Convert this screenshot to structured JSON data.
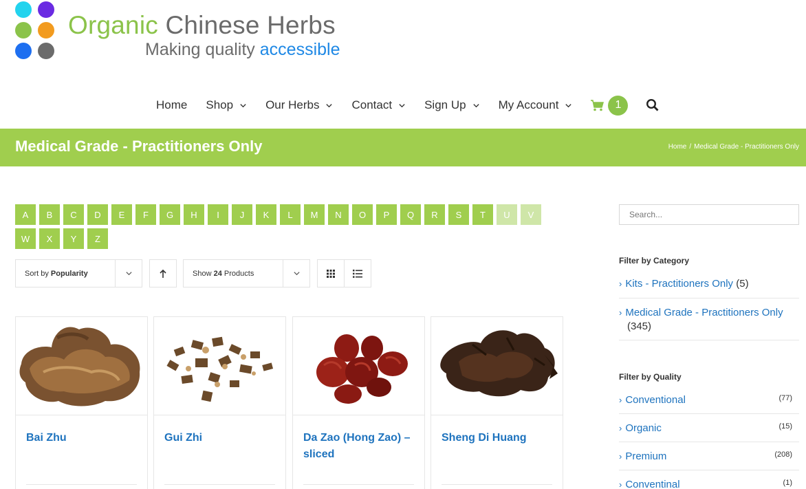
{
  "brand": {
    "name_part1": "Organic",
    "name_part2": "Chinese Herbs",
    "tagline_part1": "Making quality",
    "tagline_part2": "accessible",
    "colors": {
      "green": "#8bc34a",
      "blue": "#1e88e5",
      "gray": "#6b6b6b"
    }
  },
  "nav": {
    "items": [
      {
        "label": "Home",
        "has_menu": false
      },
      {
        "label": "Shop",
        "has_menu": true
      },
      {
        "label": "Our Herbs",
        "has_menu": true
      },
      {
        "label": "Contact",
        "has_menu": true
      },
      {
        "label": "Sign Up",
        "has_menu": true
      },
      {
        "label": "My Account",
        "has_menu": true
      }
    ],
    "cart_count": "1",
    "cart_icon": "cart-icon",
    "search_icon": "search-icon"
  },
  "page": {
    "title": "Medical Grade - Practitioners Only",
    "breadcrumb": [
      "Home",
      "Medical Grade - Practitioners Only"
    ],
    "accent": "#a0ce4e"
  },
  "alphabet": {
    "letters": [
      "A",
      "B",
      "C",
      "D",
      "E",
      "F",
      "G",
      "H",
      "I",
      "J",
      "K",
      "L",
      "M",
      "N",
      "O",
      "P",
      "Q",
      "R",
      "S",
      "T",
      "U",
      "V",
      "W",
      "X",
      "Y",
      "Z"
    ],
    "disabled": [
      "U",
      "V"
    ]
  },
  "controls": {
    "sort_prefix": "Sort by",
    "sort_value": "Popularity",
    "show_prefix": "Show",
    "show_value": "24 Products",
    "show_suffix": "Products",
    "show_count": "24"
  },
  "products": [
    {
      "name": "Bai Zhu"
    },
    {
      "name": "Gui Zhi"
    },
    {
      "name": "Da Zao (Hong Zao) – sliced"
    },
    {
      "name": "Sheng Di Huang"
    }
  ],
  "sidebar": {
    "search_placeholder": "Search...",
    "category_heading": "Filter by Category",
    "categories": [
      {
        "label": "Kits - Practitioners Only",
        "count": "(5)"
      },
      {
        "label": "Medical Grade - Practitioners Only",
        "count": "(345)"
      }
    ],
    "quality_heading": "Filter by Quality",
    "qualities": [
      {
        "label": "Conventional",
        "count": "(77)"
      },
      {
        "label": "Organic",
        "count": "(15)"
      },
      {
        "label": "Premium",
        "count": "(208)"
      },
      {
        "label": "Conventinal",
        "count": "(1)"
      }
    ]
  }
}
